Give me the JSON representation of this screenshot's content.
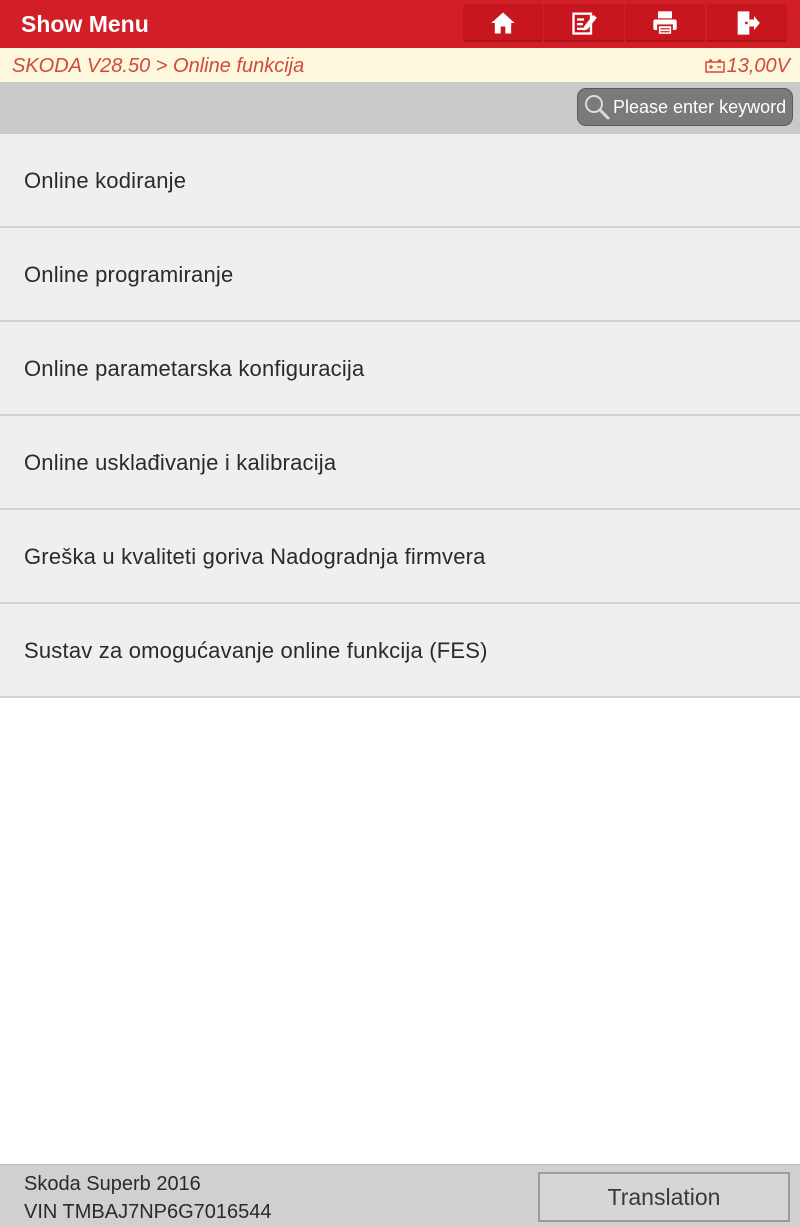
{
  "header": {
    "title": "Show Menu",
    "buttons": [
      {
        "icon": "home-icon"
      },
      {
        "icon": "edit-report-icon"
      },
      {
        "icon": "print-icon"
      },
      {
        "icon": "exit-icon"
      }
    ],
    "accent_color": "#d21e26"
  },
  "breadcrumb": {
    "path": "SKODA V28.50 > Online funkcija",
    "voltage": "13,00V",
    "voltage_icon": "battery-icon"
  },
  "search": {
    "placeholder": "Please enter keyword",
    "icon": "search-icon"
  },
  "menu": {
    "items": [
      {
        "label": "Online kodiranje"
      },
      {
        "label": "Online programiranje"
      },
      {
        "label": "Online parametarska konfiguracija"
      },
      {
        "label": "Online usklađivanje i kalibracija"
      },
      {
        "label": "Greška u kvaliteti goriva Nadogradnja firmvera"
      },
      {
        "label": "Sustav za omogućavanje online funkcija (FES)"
      }
    ]
  },
  "footer": {
    "vehicle": "Skoda Superb 2016",
    "vin": "VIN TMBAJ7NP6G7016544",
    "translation_label": "Translation"
  }
}
